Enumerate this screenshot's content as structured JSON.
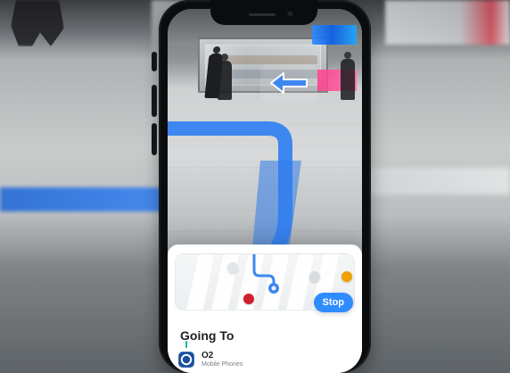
{
  "ui": {
    "destination_header": "Going To",
    "destination": {
      "name": "O2",
      "category": "Mobile Phones"
    },
    "actions": {
      "stop_label": "Stop"
    }
  },
  "colors": {
    "route_blue": "#3f87f0",
    "button_blue": "#2f8cff",
    "poi_red": "#d21f2b",
    "poi_orange": "#f0a000"
  },
  "icons": {
    "arrow": "left-arrow-icon",
    "destination": "o2-logo-icon"
  }
}
